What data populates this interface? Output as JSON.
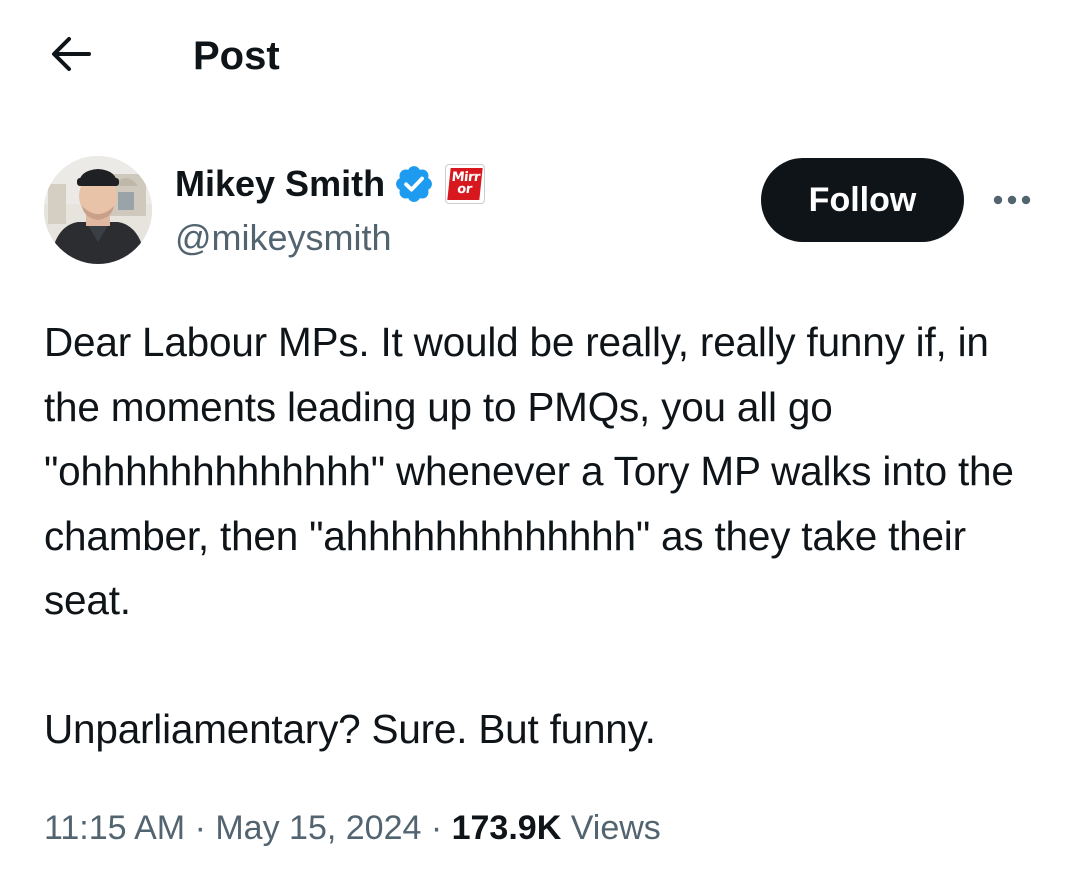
{
  "header": {
    "back_icon": "arrow-left-icon",
    "title": "Post"
  },
  "author": {
    "display_name": "Mikey Smith",
    "handle": "@mikeysmith",
    "verified_icon": "verified-badge-icon",
    "verified_color": "#1d9bf0",
    "affiliate_logo_line1": "Mirr",
    "affiliate_logo_line2": "or",
    "affiliate_color": "#d7191f"
  },
  "actions": {
    "follow_label": "Follow",
    "more_icon": "more-horizontal-icon"
  },
  "tweet": {
    "text": "Dear Labour MPs. It would be really, really funny if, in the moments leading up to PMQs, you all go \"ohhhhhhhhhhhhh\" whenever a Tory MP walks into the chamber, then \"ahhhhhhhhhhhhh\" as they take their seat.\n\nUnparliamentary? Sure. But funny."
  },
  "meta": {
    "time": "11:15 AM",
    "separator": " · ",
    "date": "May 15, 2024",
    "views_count": "173.9K",
    "views_label": " Views"
  },
  "colors": {
    "text_primary": "#0f1419",
    "text_secondary": "#536471",
    "button_dark": "#0f1419",
    "background": "#ffffff"
  }
}
